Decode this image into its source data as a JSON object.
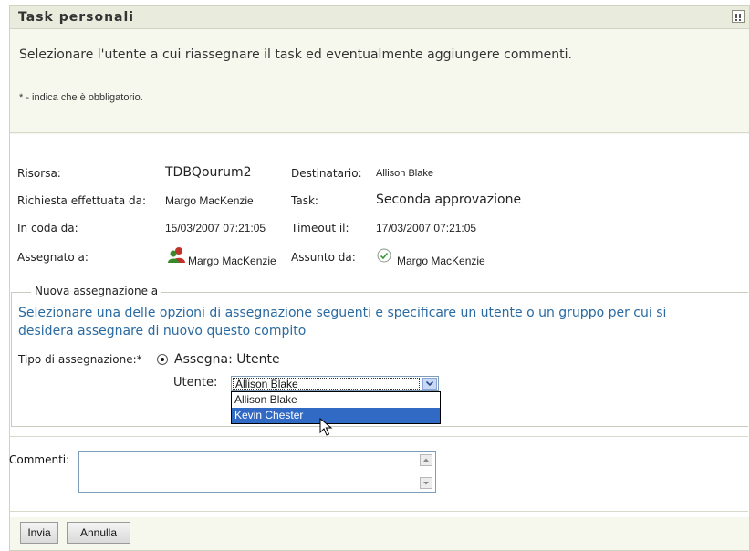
{
  "panel": {
    "title": "Task personali",
    "intro": "Selezionare l'utente a cui riassegnare il task ed eventualmente aggiungere commenti.",
    "required_note": "* - indica che è obbligatorio."
  },
  "details": {
    "risorsa_label": "Risorsa:",
    "risorsa_value": "TDBQourum2",
    "destinatario_label": "Destinatario:",
    "destinatario_value": "Allison Blake",
    "richiesta_label": "Richiesta effettuata da:",
    "richiesta_value": "Margo MacKenzie",
    "task_label": "Task:",
    "task_value": "Seconda approvazione",
    "coda_label": "In coda da:",
    "coda_value": "15/03/2007 07:21:05",
    "timeout_label": "Timeout il:",
    "timeout_value": "17/03/2007 07:21:05",
    "assegnato_label": "Assegnato a:",
    "assegnato_value": "Margo MacKenzie",
    "assunto_label": "Assunto da:",
    "assunto_value": "Margo MacKenzie"
  },
  "reassign": {
    "legend": "Nuova assegnazione a",
    "instructions": "Selezionare una delle opzioni di assegnazione seguenti e specificare un utente o un gruppo per cui si desidera assegnare di nuovo questo compito",
    "type_label": "Tipo di assegnazione:*",
    "type_option": "Assegna: Utente",
    "user_label": "Utente:",
    "user_selected": "Allison Blake",
    "user_options": [
      "Allison Blake",
      "Kevin Chester"
    ]
  },
  "comments": {
    "label": "Commenti:"
  },
  "buttons": {
    "submit": "Invia",
    "cancel": "Annulla"
  },
  "colors": {
    "panel_bg": "#f6f8ee",
    "instruction_text": "#2a6aa0",
    "dropdown_highlight": "#316ac5"
  }
}
